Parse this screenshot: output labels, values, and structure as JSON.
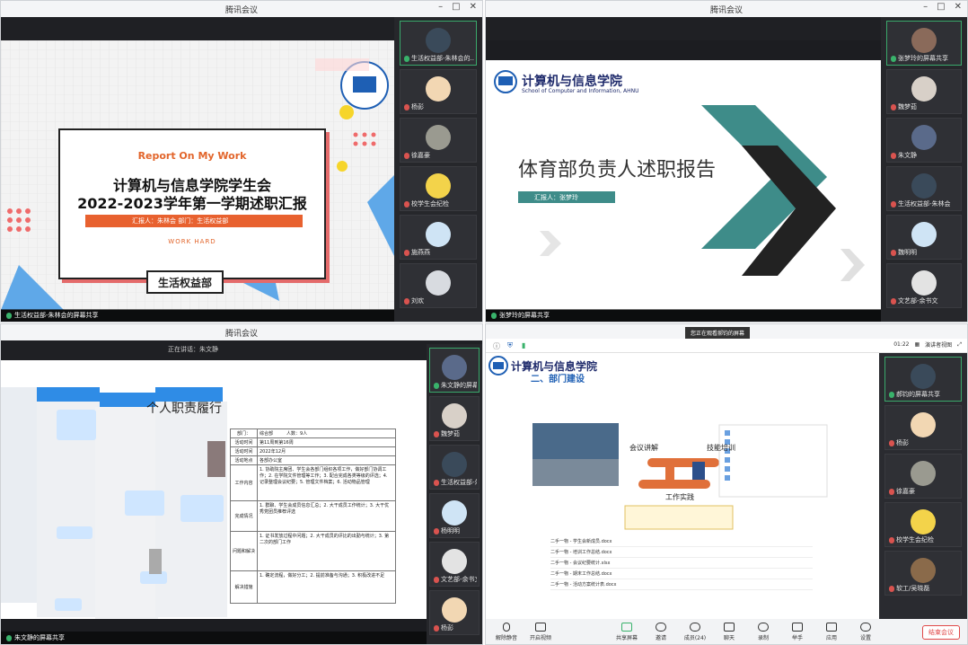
{
  "windows": [
    {
      "title": "腾讯会议",
      "slide": {
        "report_en": "Report On My Work",
        "title_line1": "计算机与信息学院学生会",
        "title_line2": "2022-2023学年第一学期述职汇报",
        "band_text": "汇报人：朱林会 部门：生活权益部",
        "work_hard": "WORK HARD",
        "dept": "生活权益部"
      },
      "share_label": "生活权益部-朱林会的屏幕共享",
      "participants": [
        {
          "name": "生活权益部-朱林会的...",
          "mic": "on"
        },
        {
          "name": "杨彭",
          "mic": "off"
        },
        {
          "name": "徐嘉豪",
          "mic": "off"
        },
        {
          "name": "校学生会纪检",
          "mic": "off"
        },
        {
          "name": "施燕燕",
          "mic": "off"
        },
        {
          "name": "刘欢",
          "mic": "off"
        }
      ]
    },
    {
      "title": "腾讯会议",
      "slide": {
        "college_cn": "计算机与信息学院",
        "college_en": "School of Computer and Information, AHNU",
        "big_title": "体育部负责人述职报告",
        "reporter": "汇报人：张梦玲"
      },
      "share_label": "张梦玲的屏幕共享",
      "participants": [
        {
          "name": "张梦玲的屏幕共享",
          "mic": "on"
        },
        {
          "name": "魏梦茹",
          "mic": "off"
        },
        {
          "name": "朱文静",
          "mic": "off"
        },
        {
          "name": "生活权益部-朱林会",
          "mic": "off"
        },
        {
          "name": "魏明明",
          "mic": "off"
        },
        {
          "name": "文艺部-余书文",
          "mic": "off"
        }
      ]
    },
    {
      "title": "腾讯会议",
      "top_label": "正在讲话：朱文静",
      "slide": {
        "heading": "个人职责履行",
        "table": {
          "head": [
            "部门：",
            "综合部",
            "人数：9人"
          ],
          "rows": [
            [
              "活动时间",
              "第11周到第16周"
            ],
            [
              "活动时间",
              "2022年12月"
            ],
            [
              "活动地点",
              "各部办公室"
            ],
            [
              "工作内容",
              "1. 协助院主席团、学生会各部门组织各项工作，做好部门协调工作；2. 在学院文件管理等工作；3. 配合完成各类等级的评选；4. 记录整理会议纪要；5. 管理文件档案；6. 活动物品管理"
            ],
            [
              "完成情况",
              "1. 群聊、学生会成员信息汇总；2. 大干成员工作统计；3. 大干优秀党团员推荐评选"
            ],
            [
              "问题和解决",
              "1. 证书发放过程中问题；2. 大干成员的评比的出勤与统计；3. 第二次的部门工作"
            ],
            [
              "解决措施",
              "1. 确定流程，做好分工；2. 提前准备与沟通；3. 积极改进不足"
            ]
          ]
        }
      },
      "share_label": "朱文静的屏幕共享",
      "participants": [
        {
          "name": "朱文静的屏幕共享",
          "mic": "on"
        },
        {
          "name": "魏梦茹",
          "mic": "off"
        },
        {
          "name": "生活权益部-朱林会",
          "mic": "off"
        },
        {
          "name": "杨明明",
          "mic": "off"
        },
        {
          "name": "文艺部-余书文",
          "mic": "off"
        },
        {
          "name": "杨彭",
          "mic": "off"
        }
      ]
    },
    {
      "banner": "您正在观看郝钧的屏幕",
      "time": "01:22",
      "view_label": "演讲者视图",
      "slide": {
        "college_cn": "计算机与信息学院",
        "section": "二、部门建设",
        "label_meeting": "会议讲解",
        "label_training": "技能培训",
        "label_work": "工作实践",
        "files": [
          "二手一物 - 学生会新成员.docx",
          "二手一物 - 培训工作总结.docx",
          "二手一物 - 会议纪要统计.xlsx",
          "二手一物 - 期末工作总结.docx",
          "二手一物 - 活动方案统计表.docx"
        ]
      },
      "participants": [
        {
          "name": "郝钧的屏幕共享",
          "mic": "on"
        },
        {
          "name": "杨彭",
          "mic": "off"
        },
        {
          "name": "徐嘉豪",
          "mic": "off"
        },
        {
          "name": "校学生会纪检",
          "mic": "off"
        },
        {
          "name": "软工/吴晓磊",
          "mic": "off"
        }
      ],
      "toolbar": [
        "解除静音",
        "开启视频",
        "共享屏幕",
        "邀请",
        "成员(24)",
        "聊天",
        "录制",
        "举手",
        "应用",
        "设置"
      ],
      "end_label": "结束会议"
    }
  ],
  "colors": {
    "accent_orange": "#e8612f",
    "teal": "#3e8c89",
    "college_blue": "#1e2a6b",
    "mic_green": "#39b26b",
    "mic_red": "#d9534f"
  }
}
